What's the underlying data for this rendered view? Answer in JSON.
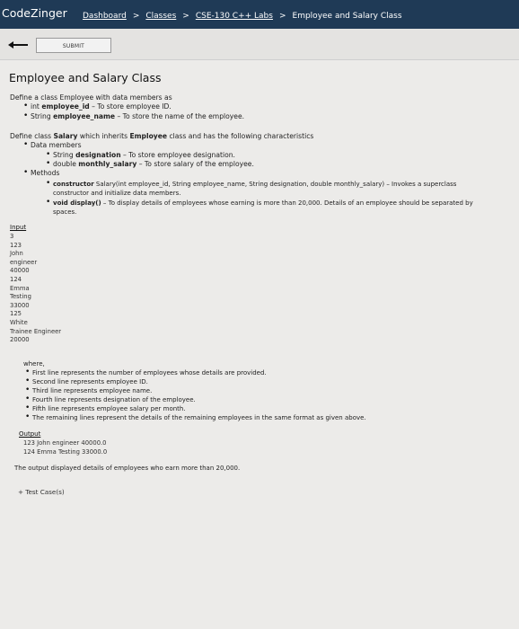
{
  "header": {
    "brand": "CodeZinger",
    "breadcrumbs": [
      "Dashboard",
      "Classes",
      "CSE-130 C++ Labs",
      "Employee and Salary Class"
    ],
    "separator": ">"
  },
  "toolbar": {
    "back_icon": "left-arrow-icon",
    "submit_label": "SUBMIT"
  },
  "problem": {
    "title": "Employee and Salary Class",
    "intro": "Define a class Employee with data members as",
    "employee_members": [
      {
        "pre": "int ",
        "bold": "employee_id",
        "post": " – To store employee ID."
      },
      {
        "pre": "String ",
        "bold": "employee_name",
        "post": " – To store the name of the employee."
      }
    ],
    "salary_intro": {
      "pre": "Define class ",
      "bold1": "Salary",
      "mid": " which inherits ",
      "bold2": "Employee",
      "post": " class and has the following characteristics"
    },
    "data_members_label": "Data members",
    "salary_members": [
      {
        "pre": "String ",
        "bold": "designation",
        "post": " – To store employee designation."
      },
      {
        "pre": "double ",
        "bold": "monthly_salary",
        "post": " – To store salary of the employee."
      }
    ],
    "methods_label": "Methods",
    "methods": [
      {
        "bold": "constructor",
        "post": " Salary(int employee_id, String employee_name, String designation, double monthly_salary) – Invokes a superclass",
        "line2": "constructor and initialize data members."
      },
      {
        "bold": "void display()",
        "post": " – To display details of employees whose earning is more than 20,000. Details of an employee should be separated by",
        "line2": "spaces."
      }
    ],
    "input_label": "Input",
    "input_lines": [
      "3",
      "123",
      "John",
      "engineer",
      "40000",
      "124",
      "Emma",
      "Testing",
      "33000",
      "125",
      "White",
      "Trainee Engineer",
      "20000"
    ],
    "where_label": "where,",
    "where_items": [
      "First line represents the number of employees whose details are provided.",
      "Second line represents employee ID.",
      "Third line represents employee name.",
      "Fourth line represents designation of the employee.",
      "Fifth line represents employee salary per month.",
      "The remaining lines represent the details of the remaining employees in the same format as given above."
    ],
    "output_label": "Output",
    "output_lines": [
      "123 John engineer 40000.0",
      "124 Emma Testing 33000.0"
    ],
    "output_note": "The output displayed details of employees who earn more than 20,000.",
    "test_case": "+ Test Case(s)"
  }
}
